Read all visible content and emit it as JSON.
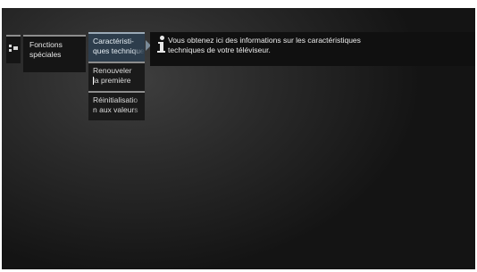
{
  "menu": {
    "icon": "menu-icon",
    "current_section": "Fonctions\nspéciales",
    "items": [
      {
        "label": "Caractéristi-\nques techniques"
      },
      {
        "label": "Renouveler\nla première"
      },
      {
        "label": "Réinitialisatio\nn aux valeurs"
      }
    ]
  },
  "info": {
    "icon": "info-icon",
    "text": "Vous obtenez ici des informations sur les caractéristiques\ntechniques de votre téléviseur."
  },
  "colors": {
    "selected_background": "#2d3d4c",
    "panel_background": "#151515",
    "panel_border": "#8d8d8d"
  }
}
